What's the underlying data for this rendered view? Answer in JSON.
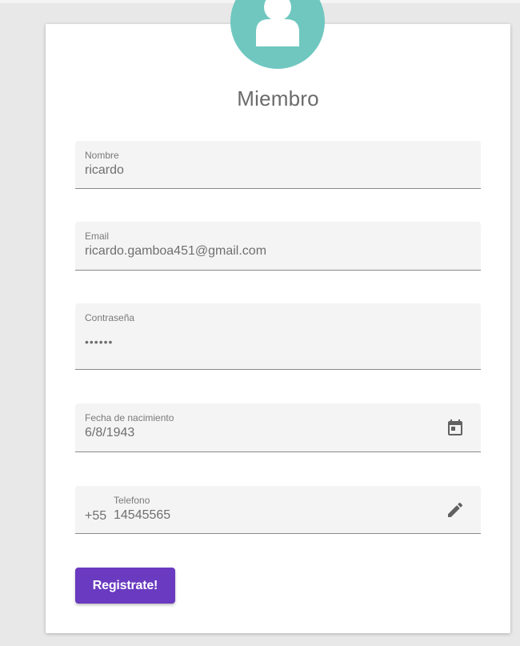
{
  "form": {
    "title": "Miembro",
    "nombre": {
      "label": "Nombre",
      "value": "ricardo"
    },
    "email": {
      "label": "Email",
      "value": "ricardo.gamboa451@gmail.com"
    },
    "password": {
      "label": "Contraseña",
      "value": "••••••"
    },
    "fecha": {
      "label": "Fecha de nacimiento",
      "value": "6/8/1943",
      "icon": "calendar-icon"
    },
    "telefono": {
      "label": "Telefono",
      "prefix": "+55",
      "value": "14545565",
      "icon": "pencil-icon"
    },
    "submit_label": "Registrate!"
  },
  "colors": {
    "avatar": "#6fc7c0",
    "button": "#6a3ac0",
    "background": "#e8e8e8"
  }
}
